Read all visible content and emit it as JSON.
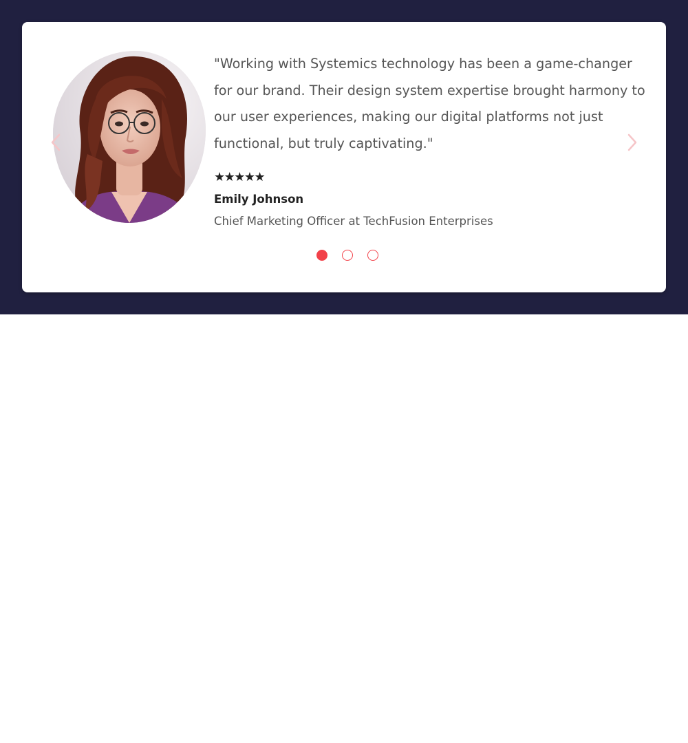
{
  "testimonial": {
    "quote": "\"Working with Systemics technology has been a game-changer for our brand. Their design system expertise brought harmony to our user experiences, making our digital platforms not just functional, but truly captivating.\"",
    "rating_text": "★★★★★",
    "rating": 5,
    "name": "Emily Johnson",
    "role": "Chief Marketing Officer at TechFusion Enterprises"
  },
  "carousel": {
    "slide_count": 3,
    "active_index": 0
  },
  "icons": {
    "prev": "chevron-left-icon",
    "next": "chevron-right-icon"
  },
  "colors": {
    "band_background": "#202040",
    "accent": "#f24149",
    "arrow": "#f6c5c8",
    "heading_text": "#222222",
    "body_text": "#555555"
  }
}
